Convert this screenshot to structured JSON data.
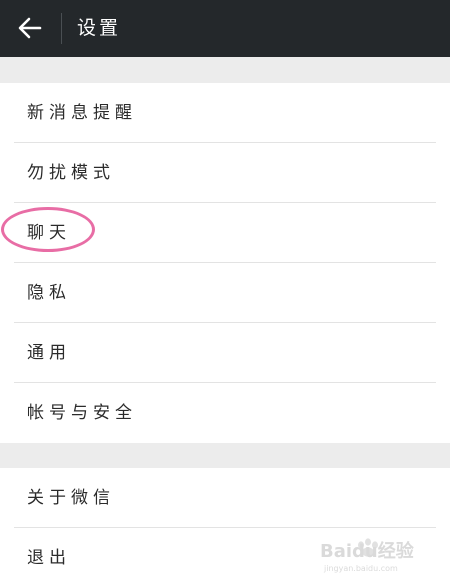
{
  "header": {
    "title": "设置",
    "back_icon": "arrow-left-icon"
  },
  "settings_group_1": [
    {
      "label": "新消息提醒"
    },
    {
      "label": "勿扰模式"
    },
    {
      "label": "聊天"
    },
    {
      "label": "隐私"
    },
    {
      "label": "通用"
    },
    {
      "label": "帐号与安全"
    }
  ],
  "settings_group_2": [
    {
      "label": "关于微信"
    },
    {
      "label": "退出"
    }
  ],
  "annotation": {
    "highlight_color": "#e86da5"
  },
  "watermark": {
    "text": "Baidu经验",
    "subtext": "jingyan.baidu.com"
  },
  "colors": {
    "header_bg": "#24282b",
    "page_bg": "#ececec",
    "row_bg": "#ffffff"
  }
}
